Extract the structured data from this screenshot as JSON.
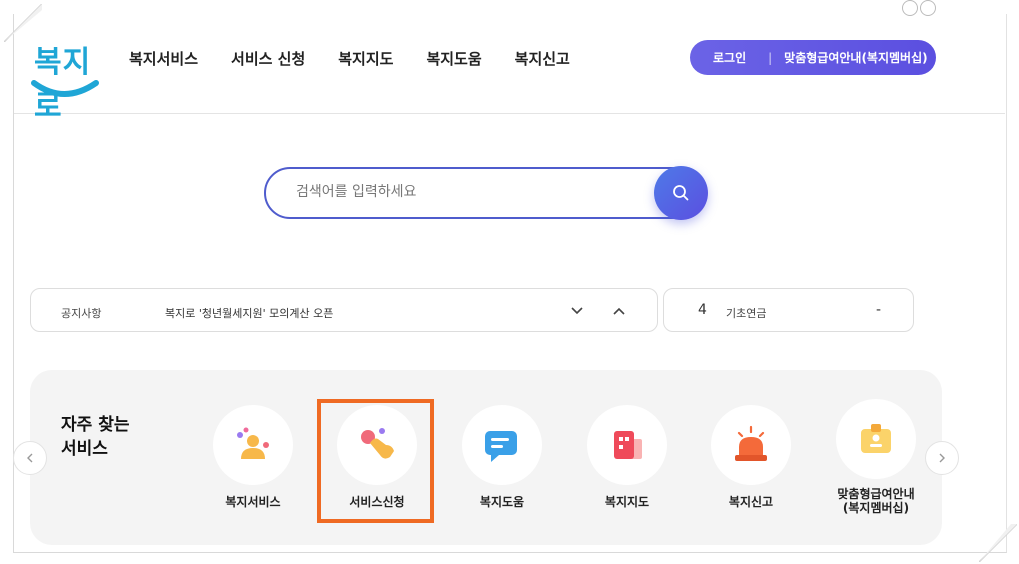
{
  "header": {
    "logo_text": "복지로",
    "nav": [
      "복지서비스",
      "서비스 신청",
      "복지지도",
      "복지도움",
      "복지신고"
    ],
    "login_label": "로그인",
    "member_label": "맞춤형급여안내(복지멤버십)"
  },
  "search": {
    "placeholder": "검색어를 입력하세요"
  },
  "notice": {
    "label": "공지사항",
    "text": "복지로 '청년월세지원' 모의계산 오픈"
  },
  "pension": {
    "rank": "4",
    "name": "기초연금",
    "change": "-"
  },
  "frequent": {
    "title_line1": "자주 찾는",
    "title_line2": "서비스",
    "items": [
      {
        "label": "복지서비스",
        "icon": "people-icon"
      },
      {
        "label": "서비스신청",
        "icon": "hand-tap-icon"
      },
      {
        "label": "복지도움",
        "icon": "chat-bubble-icon"
      },
      {
        "label": "복지지도",
        "icon": "building-map-icon"
      },
      {
        "label": "복지신고",
        "icon": "siren-icon"
      },
      {
        "label_line1": "맞춤형급여안내",
        "label_line2": "(복지멤버십)",
        "icon": "member-card-icon"
      }
    ]
  },
  "colors": {
    "accent": "#5b4fe0",
    "highlight": "#ef6a23",
    "logo": "#1fa6d6"
  }
}
